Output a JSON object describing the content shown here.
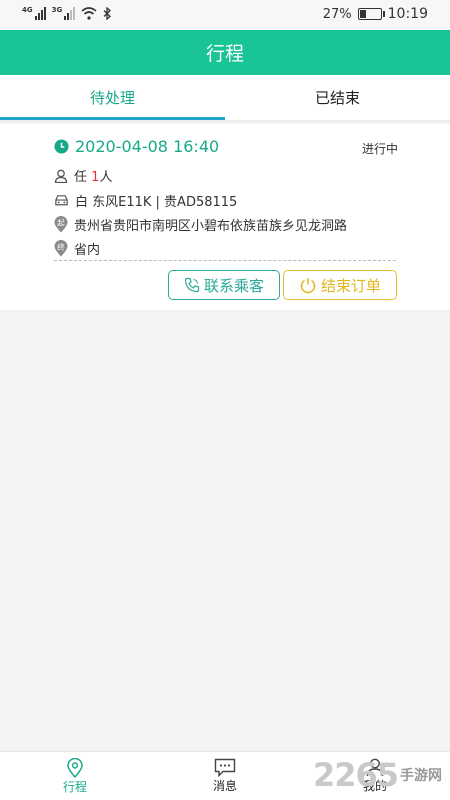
{
  "statusbar": {
    "net1": "4G",
    "net2": "3G",
    "battery": "27%",
    "time": "10:19"
  },
  "header": {
    "title": "行程"
  },
  "tabs": [
    {
      "label": "待处理",
      "active": true
    },
    {
      "label": "已结束",
      "active": false
    }
  ],
  "order": {
    "datetime": "2020-04-08 16:40",
    "status": "进行中",
    "passenger_surname": "任",
    "passenger_count": "1",
    "passenger_unit": "人",
    "vehicle": "白 东风E11K | 贵AD58115",
    "start_marker": "起",
    "start_address": "贵州省贵阳市南明区小碧布依族苗族乡见龙洞路",
    "end_marker": "终",
    "end_address": "省内"
  },
  "actions": {
    "contact_label": "联系乘客",
    "end_label": "结束订单"
  },
  "bottom_nav": [
    {
      "label": "行程",
      "icon": "location-pin-icon",
      "active": true
    },
    {
      "label": "消息",
      "icon": "message-icon",
      "active": false
    },
    {
      "label": "我的",
      "icon": "user-icon",
      "active": false
    }
  ],
  "watermark": {
    "number": "2265",
    "text": "手游网"
  },
  "colors": {
    "primary": "#19c496",
    "accent_text": "#19a98a",
    "tab_indicator": "#1fa3c9",
    "contact_border": "#2aa89a",
    "end_border": "#e8c22e",
    "count_red": "#e63232"
  }
}
